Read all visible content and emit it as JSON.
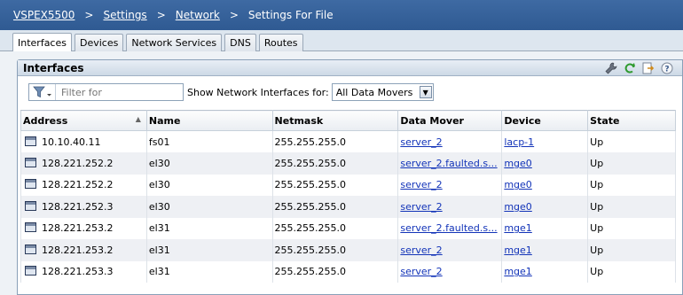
{
  "breadcrumb": {
    "system": "VSPEX5500",
    "settings": "Settings",
    "network": "Network",
    "current": "Settings For File",
    "separator": ">"
  },
  "tabs": [
    "Interfaces",
    "Devices",
    "Network Services",
    "DNS",
    "Routes"
  ],
  "panel": {
    "title": "Interfaces",
    "header_icons": [
      "wrench-icon",
      "refresh-icon",
      "export-icon",
      "help-icon"
    ]
  },
  "toolbar": {
    "filter_placeholder": "Filter for",
    "show_label": "Show Network Interfaces for:",
    "scope_value": "All Data Movers"
  },
  "table": {
    "columns": [
      "Address",
      "Name",
      "Netmask",
      "Data Mover",
      "Device",
      "State"
    ],
    "rows": [
      {
        "address": "10.10.40.11",
        "name": "fs01",
        "netmask": "255.255.255.0",
        "data_mover": "server_2",
        "device": "lacp-1",
        "state": "Up"
      },
      {
        "address": "128.221.252.2",
        "name": "el30",
        "netmask": "255.255.255.0",
        "data_mover": "server_2.faulted.s...",
        "device": "mge0",
        "state": "Up"
      },
      {
        "address": "128.221.252.2",
        "name": "el30",
        "netmask": "255.255.255.0",
        "data_mover": "server_2",
        "device": "mge0",
        "state": "Up"
      },
      {
        "address": "128.221.252.3",
        "name": "el30",
        "netmask": "255.255.255.0",
        "data_mover": "server_2",
        "device": "mge0",
        "state": "Up"
      },
      {
        "address": "128.221.253.2",
        "name": "el31",
        "netmask": "255.255.255.0",
        "data_mover": "server_2.faulted.s...",
        "device": "mge1",
        "state": "Up"
      },
      {
        "address": "128.221.253.2",
        "name": "el31",
        "netmask": "255.255.255.0",
        "data_mover": "server_2",
        "device": "mge1",
        "state": "Up"
      },
      {
        "address": "128.221.253.3",
        "name": "el31",
        "netmask": "255.255.255.0",
        "data_mover": "server_2",
        "device": "mge1",
        "state": "Up"
      }
    ]
  },
  "colors": {
    "header_bar": "#3e6aa3",
    "link": "#1233b8",
    "row_alt": "#eef0f4"
  }
}
